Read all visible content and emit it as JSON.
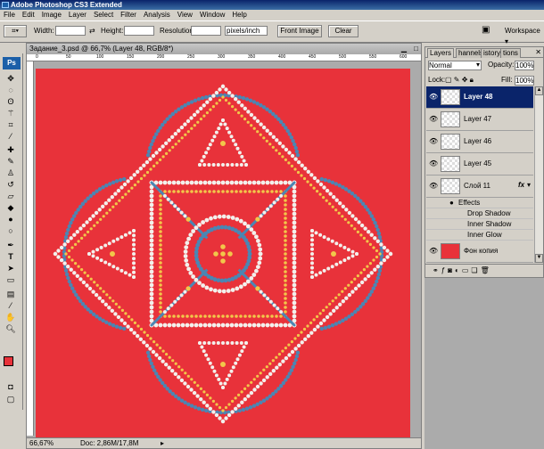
{
  "app": {
    "title": "Adobe Photoshop CS3 Extended"
  },
  "menu": [
    "File",
    "Edit",
    "Image",
    "Layer",
    "Select",
    "Filter",
    "Analysis",
    "View",
    "Window",
    "Help"
  ],
  "options": {
    "width_label": "Width:",
    "height_label": "Height:",
    "resolution_label": "Resolution:",
    "units_value": "pixels/inch",
    "front_image_label": "Front Image",
    "clear_label": "Clear",
    "workspace_label": "Workspace"
  },
  "document": {
    "title": "Задание_3.psd @ 66,7% (Layer 48, RGB/8*)",
    "zoom": "66,67%",
    "doc_info": "Doc: 2,86M/17,8M",
    "ruler_ticks": [
      "0",
      "50",
      "100",
      "150",
      "200",
      "250",
      "300",
      "350",
      "400",
      "450",
      "500",
      "550",
      "600"
    ]
  },
  "layers_panel": {
    "tabs": [
      "Layers",
      "hannels",
      "istory",
      "tions"
    ],
    "blend_mode": "Normal",
    "opacity_label": "Opacity:",
    "opacity_value": "100%",
    "lock_label": "Lock:",
    "fill_label": "Fill:",
    "fill_value": "100%",
    "layers": [
      {
        "name": "Layer 48",
        "selected": true
      },
      {
        "name": "Layer 47",
        "selected": false
      },
      {
        "name": "Layer 46",
        "selected": false
      },
      {
        "name": "Layer 45",
        "selected": false
      },
      {
        "name": "Слой 11",
        "selected": false,
        "fx": "fx"
      },
      {
        "name": "Фон копия",
        "selected": false
      }
    ],
    "effects_label": "Effects",
    "effects": [
      "Drop Shadow",
      "Inner Shadow",
      "Inner Glow"
    ]
  },
  "colors": {
    "canvas_red": "#e8323a",
    "dot_white": "#f3f0ec",
    "dot_blue": "#4b86b3",
    "dot_yellow": "#f2c64a",
    "selection": "#0a246a"
  }
}
